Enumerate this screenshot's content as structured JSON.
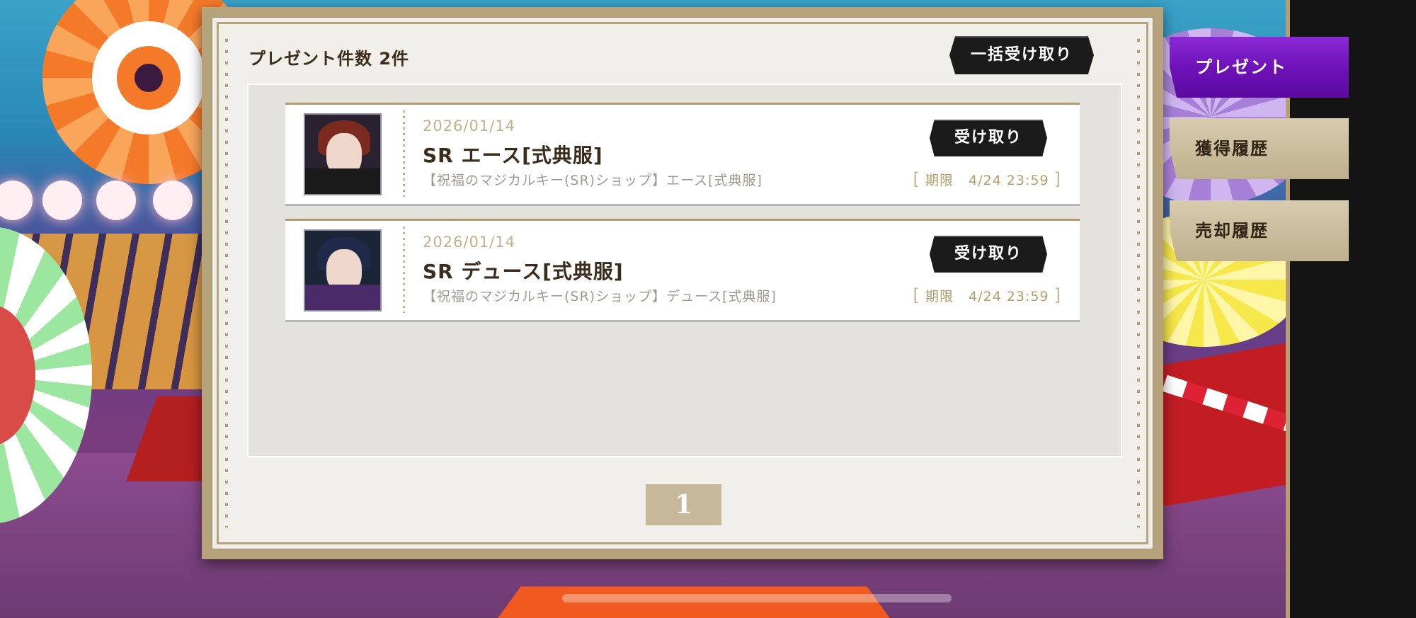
{
  "header": {
    "count_label": "プレゼント件数 2件",
    "receive_all_label": "一括受け取り"
  },
  "presents": [
    {
      "date": "2026/01/14",
      "name": "SR エース[式典服]",
      "description": "【祝福のマジカルキー(SR)ショップ】エース[式典服]",
      "receive_label": "受け取り",
      "limit_label": "期限",
      "limit_value": "4/24 23:59",
      "thumb_colors": {
        "hair": "#7a2a1e",
        "cloak": "#1a1a1a"
      }
    },
    {
      "date": "2026/01/14",
      "name": "SR デュース[式典服]",
      "description": "【祝福のマジカルキー(SR)ショップ】デュース[式典服]",
      "receive_label": "受け取り",
      "limit_label": "期限",
      "limit_value": "4/24 23:59",
      "thumb_colors": {
        "hair": "#1f2a4a",
        "cloak": "#4b2a6a"
      }
    }
  ],
  "pagination": {
    "current_page": "1"
  },
  "side_tabs": {
    "present": "プレゼント",
    "acquire_history": "獲得履歴",
    "sell_history": "売却履歴"
  },
  "colors": {
    "active_tab": "#6e12b8",
    "inactive_tab": "#cbbd9d",
    "button_dark": "#1b1b1b",
    "panel_frame": "#b6a37b"
  }
}
